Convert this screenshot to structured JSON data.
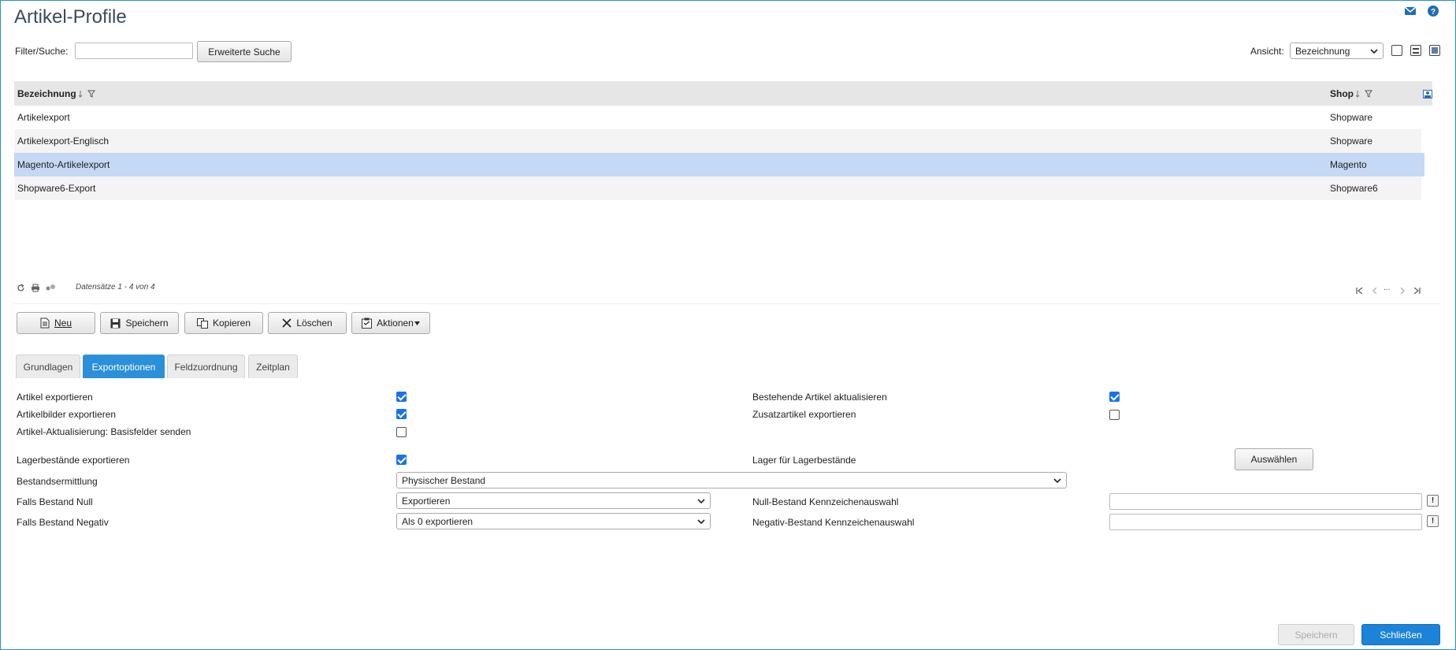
{
  "page": {
    "title": "Artikel-Profile"
  },
  "filter": {
    "label": "Filter/Suche:",
    "value": "",
    "advanced_button": "Erweiterte Suche"
  },
  "view": {
    "label": "Ansicht:",
    "selected": "Bezeichnung"
  },
  "grid": {
    "columns": [
      "Bezeichnung",
      "Shop"
    ],
    "rows": [
      [
        "Artikelexport",
        "Shopware"
      ],
      [
        "Artikelexport-Englisch",
        "Shopware"
      ],
      [
        "Magento-Artikelexport",
        "Magento"
      ],
      [
        "Shopware6-Export",
        "Shopware6"
      ]
    ],
    "selected_row": 2,
    "record_info": "Datensätze 1 - 4 von 4",
    "pager_ellipsis": "..."
  },
  "toolbar": {
    "new": "Neu",
    "save": "Speichern",
    "copy": "Kopieren",
    "delete": "Löschen",
    "actions": "Aktionen"
  },
  "tabs": [
    "Grundlagen",
    "Exportoptionen",
    "Feldzuordnung",
    "Zeitplan"
  ],
  "active_tab": 1,
  "form": {
    "artikel_exportieren": {
      "label": "Artikel exportieren",
      "checked": true
    },
    "artikelbilder": {
      "label": "Artikelbilder exportieren",
      "checked": true
    },
    "basisfelder": {
      "label": "Artikel-Aktualisierung: Basisfelder senden",
      "checked": false
    },
    "bestehende": {
      "label": "Bestehende Artikel aktualisieren",
      "checked": true
    },
    "zusatzartikel": {
      "label": "Zusatzartikel exportieren",
      "checked": false
    },
    "lagerbestaende": {
      "label": "Lagerbestände exportieren",
      "checked": true
    },
    "lager": {
      "label": "Lager für Lagerbestände",
      "button": "Auswählen"
    },
    "bestandsermittlung": {
      "label": "Bestandsermittlung",
      "value": "Physischer Bestand"
    },
    "bestand_null": {
      "label": "Falls Bestand Null",
      "value": "Exportieren"
    },
    "bestand_negativ": {
      "label": "Falls Bestand Negativ",
      "value": "Als 0 exportieren"
    },
    "null_kennzeichen": {
      "label": "Null-Bestand Kennzeichenauswahl",
      "value": ""
    },
    "negativ_kennzeichen": {
      "label": "Negativ-Bestand Kennzeichenauswahl",
      "value": ""
    }
  },
  "footer": {
    "save": "Speichern",
    "close": "Schließen"
  },
  "icons": {
    "mail": "mail-icon",
    "help": "help-icon",
    "refresh": "refresh-icon",
    "print": "print-icon",
    "columns": "column-settings-icon",
    "sort": "sort-icon",
    "filter": "filter-icon"
  },
  "colors": {
    "accent": "#2b90d9",
    "selected_row": "#c5d9f5",
    "primary_button": "#1b83d8"
  }
}
